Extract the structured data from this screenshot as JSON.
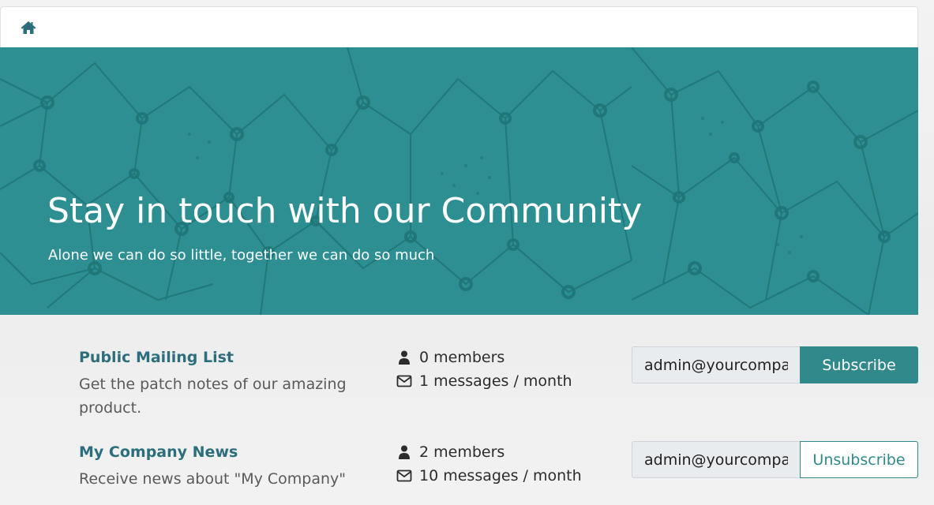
{
  "breadcrumb": {
    "home_icon": "home-icon"
  },
  "hero": {
    "title": "Stay in touch with our Community",
    "subtitle": "Alone we can do so little, together we can do so much",
    "background_color": "#2d8f91"
  },
  "mailing_lists": [
    {
      "name": "Public Mailing List",
      "description": "Get the patch notes of our amazing product.",
      "members": "0 members",
      "messages": "1 messages / month",
      "email_value": "admin@yourcompany.example.com",
      "button_label": "Subscribe"
    },
    {
      "name": "My Company News",
      "description": "Receive news about \"My Company\"",
      "members": "2 members",
      "messages": "10 messages / month",
      "email_value": "admin@yourcompany.example.com",
      "button_label": "Unsubscribe"
    }
  ],
  "colors": {
    "accent": "#31898c",
    "list_title": "#2c6e7b",
    "hero_bg": "#2d8f91"
  },
  "icons": {
    "members": "user-icon",
    "messages": "envelope-icon"
  }
}
